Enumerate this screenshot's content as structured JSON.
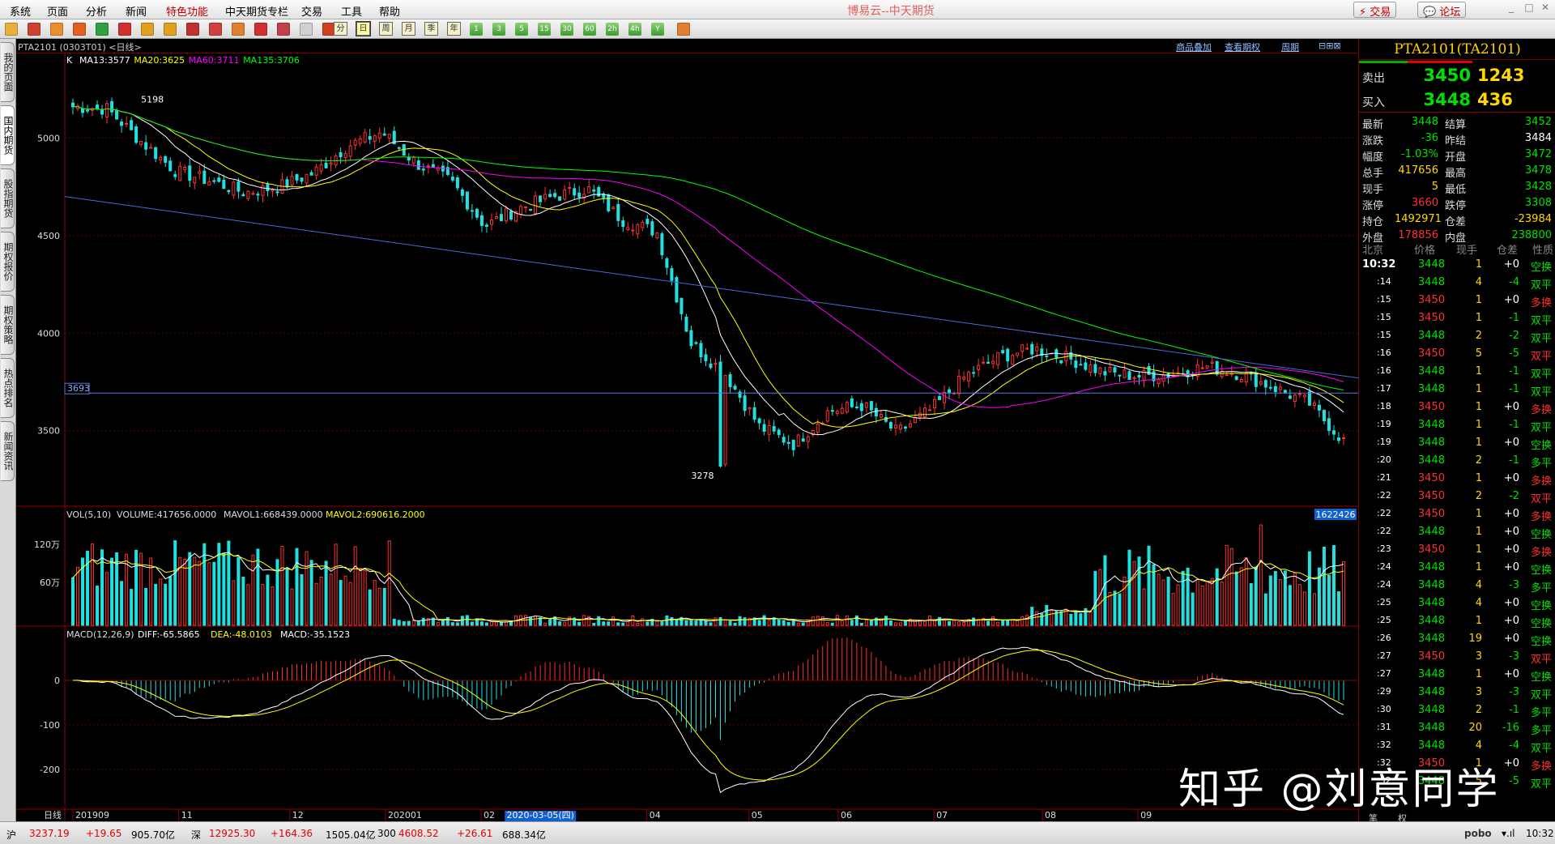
{
  "app_title": "博易云--中天期货",
  "menu": [
    "系统",
    "页面",
    "分析",
    "新闻",
    "特色功能",
    "中天期货专栏",
    "交易",
    "工具",
    "帮助"
  ],
  "top_buttons": {
    "trade": "交易",
    "forum": "论坛"
  },
  "toolbar_periods": [
    "周",
    "月",
    "季",
    "年",
    "1",
    "3",
    "5",
    "15",
    "30",
    "60",
    "2h",
    "4h",
    "Y"
  ],
  "left_tabs": [
    "我的页面",
    "国内期货",
    "股指期货",
    "期权报价",
    "期权策略",
    "热点排名",
    "新闻资讯"
  ],
  "chart_header": {
    "symbol": "PTA2101 (0303T01) <日线>",
    "links": [
      "商品叠加",
      "查看期权",
      "周期"
    ]
  },
  "panels": {
    "main": {
      "label": "K",
      "indicators": [
        {
          "text": "MA13:3577",
          "color": "#ffffff"
        },
        {
          "text": "MA20:3625",
          "color": "#ffff00"
        },
        {
          "text": "MA60:3711",
          "color": "#ff00ff"
        },
        {
          "text": "MA135:3706",
          "color": "#00ff00"
        }
      ],
      "ylabels": [
        "5000",
        "4500",
        "4000",
        "3500"
      ],
      "high_label": "5198",
      "low_label": "3278",
      "hline_label": "3693"
    },
    "volume": {
      "label": "VOL(5,10)",
      "text1": "VOLUME:417656.0000",
      "text2": "MAVOL1:668439.0000",
      "text3": "MAVOL2:690616.2000",
      "ylabels": [
        "120万",
        "60万"
      ],
      "badge": "1622426"
    },
    "macd": {
      "label": "MACD(12,26,9)",
      "text1": "DIFF:-65.5865",
      "text2": "DEA:-48.0103",
      "text3": "MACD:-35.1523",
      "ylabels": [
        "0",
        "-100",
        "-200"
      ]
    }
  },
  "xaxis": {
    "first_label": "日线",
    "labels": [
      "201909",
      "11",
      "12",
      "202001",
      "02",
      "03",
      "04",
      "05",
      "06",
      "07",
      "08",
      "09"
    ],
    "cursor_date": "2020-03-05(四)"
  },
  "chart_data": {
    "type": "candlestick",
    "title": "PTA2101 日线",
    "ylim": [
      3200,
      5350
    ],
    "ma_latest": {
      "MA13": 3577,
      "MA20": 3625,
      "MA60": 3711,
      "MA135": 3706
    },
    "high": 5198,
    "low": 3278,
    "reference_line": 3693,
    "close_trajectory": [
      5160,
      5150,
      4980,
      4830,
      4780,
      4720,
      4750,
      4820,
      4960,
      5030,
      4870,
      4780,
      4550,
      4640,
      4700,
      4740,
      4580,
      4520,
      3950,
      3790,
      3520,
      3430,
      3600,
      3630,
      3490,
      3610,
      3780,
      3880,
      3920,
      3870,
      3800,
      3780,
      3790,
      3830,
      3790,
      3720,
      3640,
      3448
    ],
    "volume": {
      "latest": 417656,
      "MAVOL1": 668439,
      "MAVOL2": 690616.2
    },
    "macd": {
      "DIFF": -65.5865,
      "DEA": -48.0103,
      "MACD": -35.1523
    }
  },
  "quote": {
    "title": "PTA2101(TA2101)",
    "sell": {
      "label": "卖出",
      "price": "3450",
      "vol": "1243"
    },
    "buy": {
      "label": "买入",
      "price": "3448",
      "vol": "436"
    },
    "stats": [
      {
        "l1": "最新",
        "v1": "3448",
        "c1": "#00e000",
        "l2": "结算",
        "v2": "3452",
        "c2": "#00e000"
      },
      {
        "l1": "涨跌",
        "v1": "-36",
        "c1": "#00e000",
        "l2": "昨结",
        "v2": "3484",
        "c2": "#ffffff"
      },
      {
        "l1": "幅度",
        "v1": "-1.03%",
        "c1": "#00e000",
        "l2": "开盘",
        "v2": "3472",
        "c2": "#00e000"
      },
      {
        "l1": "总手",
        "v1": "417656",
        "c1": "#ffd700",
        "l2": "最高",
        "v2": "3478",
        "c2": "#00e000"
      },
      {
        "l1": "现手",
        "v1": "5",
        "c1": "#ffd700",
        "l2": "最低",
        "v2": "3428",
        "c2": "#00e000"
      },
      {
        "l1": "涨停",
        "v1": "3660",
        "c1": "#ff3030",
        "l2": "跌停",
        "v2": "3308",
        "c2": "#00e000"
      },
      {
        "l1": "持仓",
        "v1": "1492971",
        "c1": "#ffd700",
        "l2": "仓差",
        "v2": "-23984",
        "c2": "#ffd700"
      },
      {
        "l1": "外盘",
        "v1": "178856",
        "c1": "#ff3030",
        "l2": "内盘",
        "v2": "238800",
        "c2": "#00e000"
      }
    ],
    "tick_header": [
      "北京",
      "价格",
      "现手",
      "仓差",
      "性质"
    ],
    "ticks": [
      {
        "t": "10:32",
        "p": "3448",
        "pc": "#00e000",
        "v": "1",
        "d": "+0",
        "n": "空换",
        "nc": "#00e000"
      },
      {
        "t": ":14",
        "p": "3448",
        "pc": "#00e000",
        "v": "4",
        "d": "-4",
        "n": "双平",
        "nc": "#00e000"
      },
      {
        "t": ":15",
        "p": "3450",
        "pc": "#ff3030",
        "v": "1",
        "d": "+0",
        "n": "多换",
        "nc": "#ff3030"
      },
      {
        "t": ":15",
        "p": "3450",
        "pc": "#ff3030",
        "v": "1",
        "d": "-1",
        "n": "双平",
        "nc": "#00e000"
      },
      {
        "t": ":15",
        "p": "3448",
        "pc": "#00e000",
        "v": "2",
        "d": "-2",
        "n": "双平",
        "nc": "#00e000"
      },
      {
        "t": ":16",
        "p": "3450",
        "pc": "#ff3030",
        "v": "5",
        "d": "-5",
        "n": "双平",
        "nc": "#ff3030"
      },
      {
        "t": ":16",
        "p": "3448",
        "pc": "#00e000",
        "v": "1",
        "d": "-1",
        "n": "双平",
        "nc": "#00e000"
      },
      {
        "t": ":17",
        "p": "3448",
        "pc": "#00e000",
        "v": "1",
        "d": "-1",
        "n": "双平",
        "nc": "#00e000"
      },
      {
        "t": ":18",
        "p": "3450",
        "pc": "#ff3030",
        "v": "1",
        "d": "+0",
        "n": "多换",
        "nc": "#ff3030"
      },
      {
        "t": ":19",
        "p": "3448",
        "pc": "#00e000",
        "v": "1",
        "d": "-1",
        "n": "双平",
        "nc": "#00e000"
      },
      {
        "t": ":19",
        "p": "3448",
        "pc": "#00e000",
        "v": "1",
        "d": "+0",
        "n": "空换",
        "nc": "#00e000"
      },
      {
        "t": ":20",
        "p": "3448",
        "pc": "#00e000",
        "v": "2",
        "d": "-1",
        "n": "多平",
        "nc": "#00e000"
      },
      {
        "t": ":21",
        "p": "3450",
        "pc": "#ff3030",
        "v": "1",
        "d": "+0",
        "n": "多换",
        "nc": "#ff3030"
      },
      {
        "t": ":22",
        "p": "3450",
        "pc": "#ff3030",
        "v": "2",
        "d": "-2",
        "n": "双平",
        "nc": "#ff3030"
      },
      {
        "t": ":22",
        "p": "3450",
        "pc": "#ff3030",
        "v": "1",
        "d": "+0",
        "n": "多换",
        "nc": "#ff3030"
      },
      {
        "t": ":22",
        "p": "3448",
        "pc": "#00e000",
        "v": "1",
        "d": "+0",
        "n": "空换",
        "nc": "#00e000"
      },
      {
        "t": ":23",
        "p": "3450",
        "pc": "#ff3030",
        "v": "1",
        "d": "+0",
        "n": "多换",
        "nc": "#ff3030"
      },
      {
        "t": ":24",
        "p": "3448",
        "pc": "#00e000",
        "v": "1",
        "d": "+0",
        "n": "空换",
        "nc": "#00e000"
      },
      {
        "t": ":24",
        "p": "3448",
        "pc": "#00e000",
        "v": "4",
        "d": "-3",
        "n": "多平",
        "nc": "#00e000"
      },
      {
        "t": ":25",
        "p": "3448",
        "pc": "#00e000",
        "v": "4",
        "d": "+0",
        "n": "空换",
        "nc": "#00e000"
      },
      {
        "t": ":25",
        "p": "3448",
        "pc": "#00e000",
        "v": "1",
        "d": "+0",
        "n": "空换",
        "nc": "#00e000"
      },
      {
        "t": ":26",
        "p": "3448",
        "pc": "#00e000",
        "v": "19",
        "d": "+0",
        "n": "空换",
        "nc": "#00e000"
      },
      {
        "t": ":27",
        "p": "3450",
        "pc": "#ff3030",
        "v": "3",
        "d": "-3",
        "n": "双平",
        "nc": "#ff3030"
      },
      {
        "t": ":27",
        "p": "3448",
        "pc": "#00e000",
        "v": "1",
        "d": "+0",
        "n": "空换",
        "nc": "#00e000"
      },
      {
        "t": ":29",
        "p": "3448",
        "pc": "#00e000",
        "v": "3",
        "d": "-3",
        "n": "双平",
        "nc": "#00e000"
      },
      {
        "t": ":30",
        "p": "3448",
        "pc": "#00e000",
        "v": "2",
        "d": "-1",
        "n": "多平",
        "nc": "#00e000"
      },
      {
        "t": ":31",
        "p": "3448",
        "pc": "#00e000",
        "v": "20",
        "d": "-16",
        "n": "多平",
        "nc": "#00e000"
      },
      {
        "t": ":32",
        "p": "3448",
        "pc": "#00e000",
        "v": "4",
        "d": "-4",
        "n": "双平",
        "nc": "#00e000"
      },
      {
        "t": ":32",
        "p": "3450",
        "pc": "#ff3030",
        "v": "1",
        "d": "+0",
        "n": "多换",
        "nc": "#ff3030"
      },
      {
        "t": ":32",
        "p": "3448",
        "pc": "#00e000",
        "v": "5",
        "d": "-5",
        "n": "双平",
        "nc": "#00e000"
      }
    ],
    "bottom_tabs": [
      "笔",
      "权"
    ]
  },
  "statusbar": {
    "items": [
      {
        "t": "沪",
        "c": "#000000"
      },
      {
        "t": "3237.19",
        "c": "#e00000"
      },
      {
        "t": "+19.65",
        "c": "#e00000"
      },
      {
        "t": "905.70亿",
        "c": "#000000"
      },
      {
        "t": "深",
        "c": "#000000"
      },
      {
        "t": "12925.30",
        "c": "#e00000"
      },
      {
        "t": "+164.36",
        "c": "#e00000"
      },
      {
        "t": "1505.04亿",
        "c": "#000000"
      },
      {
        "t": "300",
        "c": "#000000"
      },
      {
        "t": "4608.52",
        "c": "#e00000"
      },
      {
        "t": "+26.61",
        "c": "#e00000"
      },
      {
        "t": "688.34亿",
        "c": "#000000"
      }
    ],
    "brand": "pobo",
    "time": "10:32"
  },
  "watermark": "知乎 @刘意同学"
}
